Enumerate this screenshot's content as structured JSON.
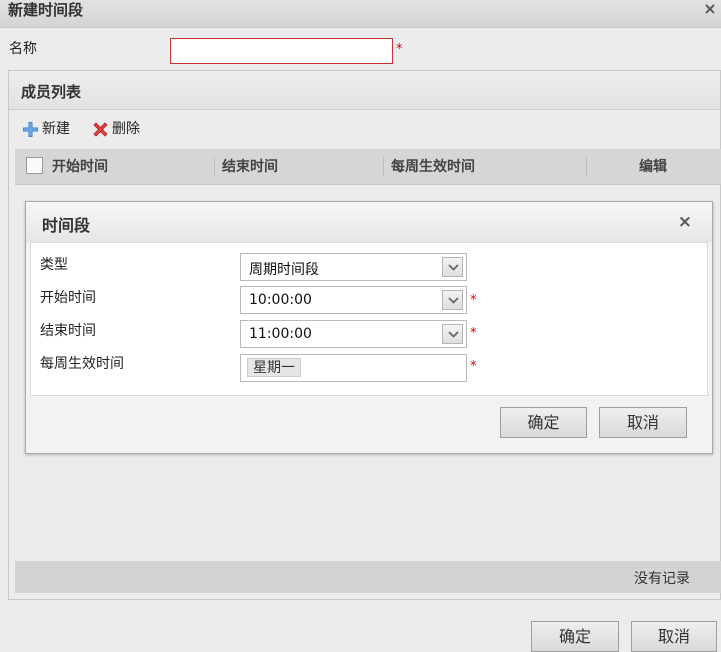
{
  "window": {
    "title": "新建时间段",
    "close_symbol": "×"
  },
  "name_field": {
    "label": "名称",
    "value": "",
    "required_mark": "*"
  },
  "member_panel": {
    "title": "成员列表",
    "toolbar": {
      "new_label": "新建",
      "new_icon": "add-plus-icon",
      "delete_label": "删除",
      "delete_icon": "delete-x-icon"
    },
    "columns": [
      "开始时间",
      "结束时间",
      "每周生效时间",
      "编辑"
    ],
    "rows": [],
    "footer_text": "没有记录"
  },
  "modal": {
    "title": "时间段",
    "close_symbol": "×",
    "fields": {
      "type": {
        "label": "类型",
        "value": "周期时间段"
      },
      "start": {
        "label": "开始时间",
        "value": "10:00:00",
        "required_mark": "*"
      },
      "end": {
        "label": "结束时间",
        "value": "11:00:00",
        "required_mark": "*"
      },
      "weekdays": {
        "label": "每周生效时间",
        "tags": [
          "星期一"
        ],
        "required_mark": "*"
      }
    },
    "confirm_label": "确定",
    "cancel_label": "取消"
  },
  "footer": {
    "confirm_label": "确定",
    "cancel_label": "取消"
  },
  "colors": {
    "error_border": "#cc3333",
    "required": "#dd0000",
    "delete_icon": "#e04040",
    "add_icon": "#3a7fd0"
  }
}
